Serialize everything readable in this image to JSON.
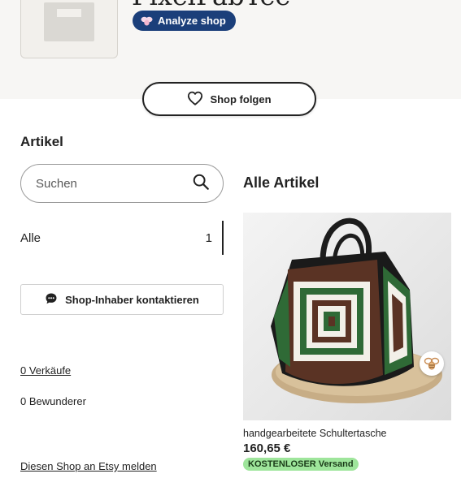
{
  "header": {
    "shop_name": "PixelFabTee",
    "analyze_label": "Analyze shop",
    "follow_label": "Shop folgen"
  },
  "sidebar": {
    "title": "Artikel",
    "search_placeholder": "Suchen",
    "categories": [
      {
        "label": "Alle",
        "count": "1"
      }
    ],
    "contact_label": "Shop-Inhaber kontaktieren",
    "sales_label": "0 Verkäufe",
    "admirers_label": "0 Bewunderer",
    "report_label": "Diesen Shop an Etsy melden"
  },
  "main": {
    "title": "Alle Artikel",
    "products": [
      {
        "title": "handgearbeitete Schultertasche",
        "price": "160,65 €",
        "shipping_badge": "KOSTENLOSER Versand",
        "badge_icon": "bee-icon"
      }
    ]
  },
  "colors": {
    "analyze_button": "#1b3f7a",
    "free_shipping_badge": "#9ee59b",
    "hero_background": "#f7f6f4"
  },
  "icons": {
    "follow": "heart-icon",
    "search": "search-icon",
    "contact": "chat-bubble-icon",
    "analyze": "bee-icon"
  }
}
